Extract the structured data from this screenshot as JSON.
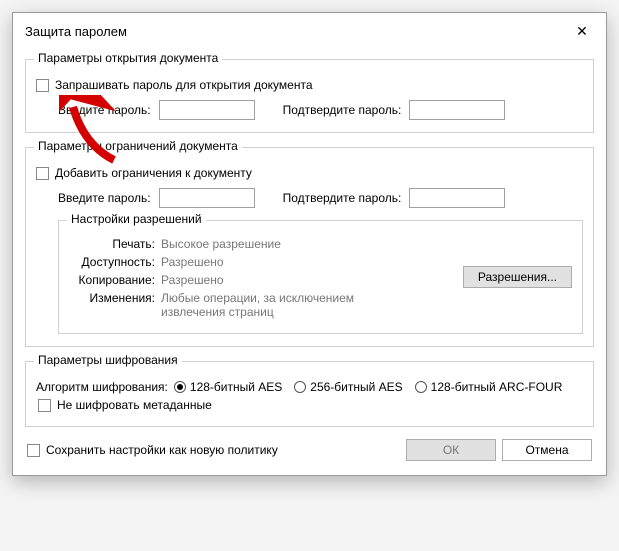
{
  "title": "Защита паролем",
  "groups": {
    "open": {
      "title": "Параметры открытия документа",
      "checkbox": "Запрашивать пароль для открытия документа",
      "pw_label": "Введите пароль:",
      "confirm_label": "Подтвердите пароль:"
    },
    "restrict": {
      "title": "Параметры ограничений документа",
      "checkbox": "Добавить ограничения к документу",
      "pw_label": "Введите пароль:",
      "confirm_label": "Подтвердите пароль:",
      "perm_title": "Настройки разрешений",
      "perm": {
        "print_l": "Печать:",
        "print_v": "Высокое разрешение",
        "access_l": "Доступность:",
        "access_v": "Разрешено",
        "copy_l": "Копирование:",
        "copy_v": "Разрешено",
        "change_l": "Изменения:",
        "change_v": "Любые операции, за исключением извлечения страниц"
      },
      "perm_btn": "Разрешения..."
    },
    "enc": {
      "title": "Параметры шифрования",
      "algo_label": "Алгоритм шифрования:",
      "opts": {
        "aes128": "128-битный AES",
        "aes256": "256-битный AES",
        "arc4": "128-битный ARC-FOUR"
      },
      "no_meta": "Не шифровать метаданные"
    }
  },
  "bottom": {
    "save_policy": "Сохранить настройки как новую политику",
    "ok": "ОК",
    "cancel": "Отмена"
  }
}
